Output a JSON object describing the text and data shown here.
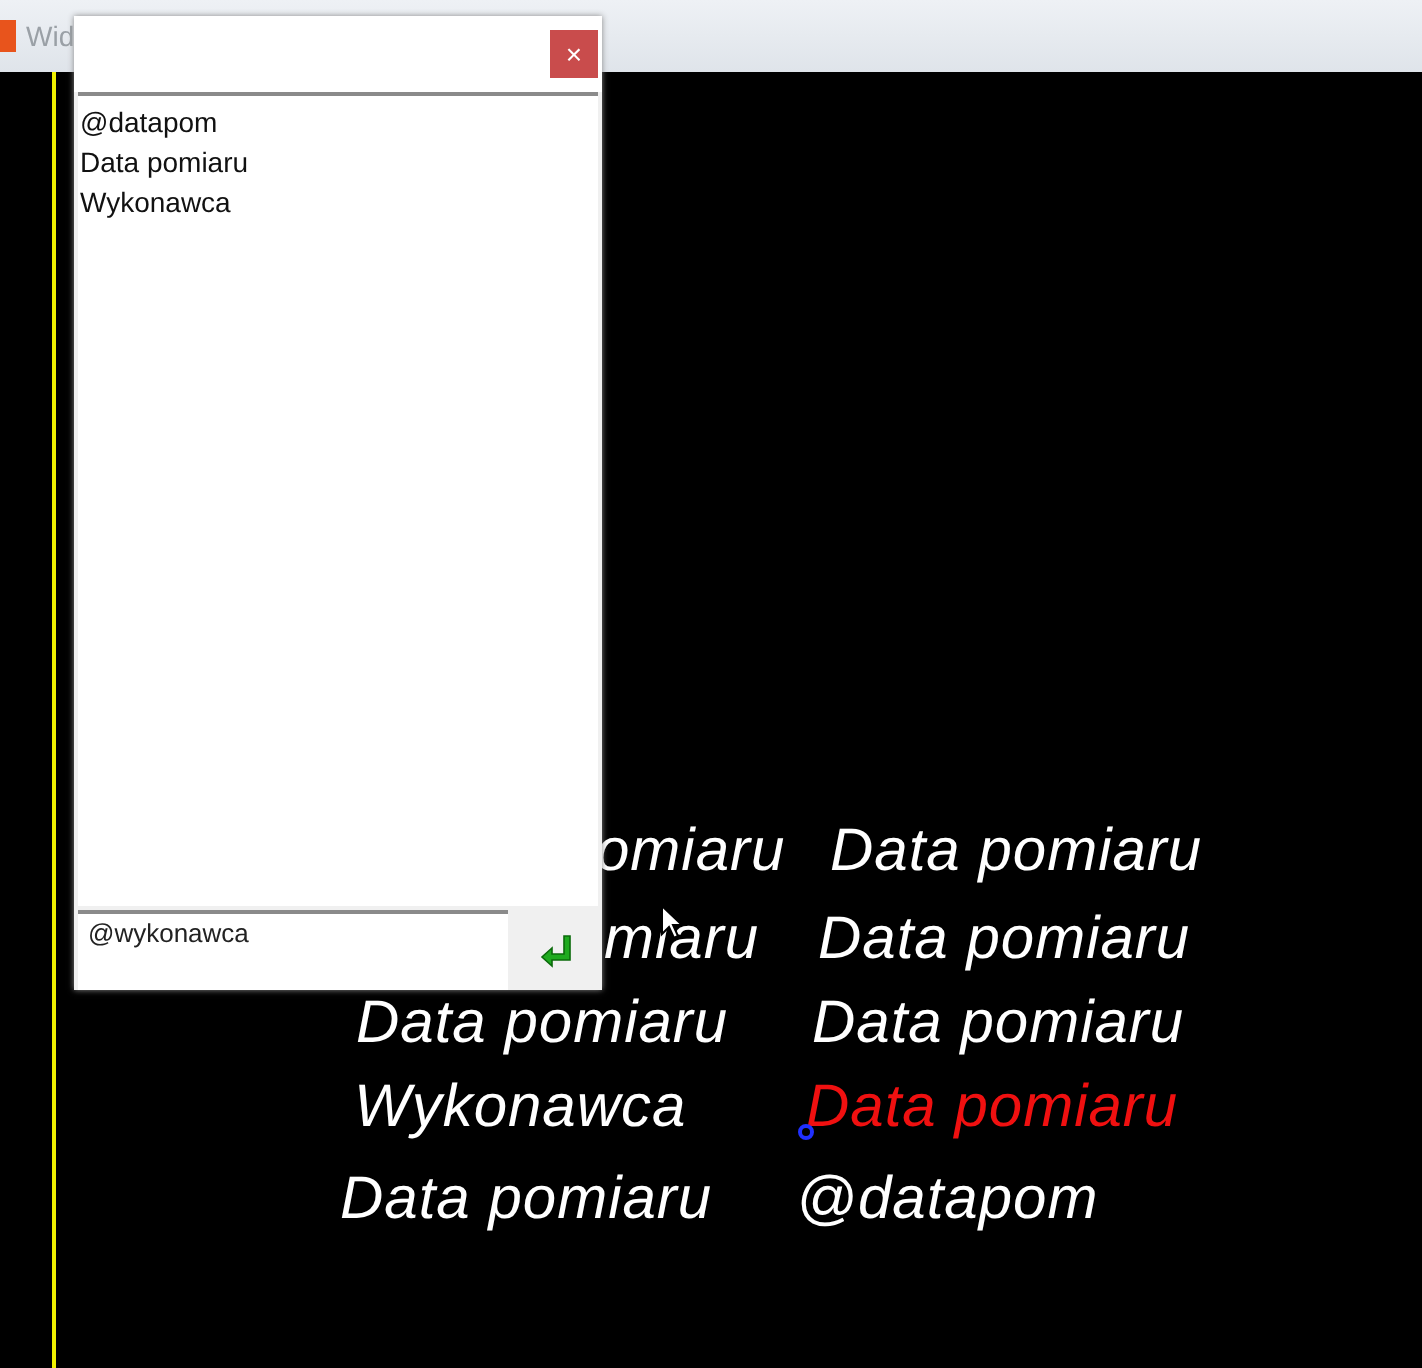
{
  "app_window": {
    "title": "Wid"
  },
  "dialog": {
    "close_label": "×",
    "items": [
      {
        "text": "@datapom"
      },
      {
        "text": "Data pomiaru"
      },
      {
        "text": "Wykonawca"
      }
    ],
    "input": {
      "value": "@wykonawca"
    }
  },
  "canvas": {
    "rows": [
      [
        {
          "text": "omiaru",
          "selected": false
        },
        {
          "text": "Data pomiaru",
          "selected": false
        }
      ],
      [
        {
          "text": "miaru",
          "selected": false
        },
        {
          "text": "Data pomiaru",
          "selected": false
        }
      ],
      [
        {
          "text": "Data pomiaru",
          "selected": false
        },
        {
          "text": "Data pomiaru",
          "selected": false
        }
      ],
      [
        {
          "text": "Wykonawca",
          "selected": false
        },
        {
          "text": "Data pomiaru",
          "selected": true
        }
      ],
      [
        {
          "text": "Data pomiaru",
          "selected": false
        },
        {
          "text": "@datapom",
          "selected": false
        }
      ]
    ]
  }
}
